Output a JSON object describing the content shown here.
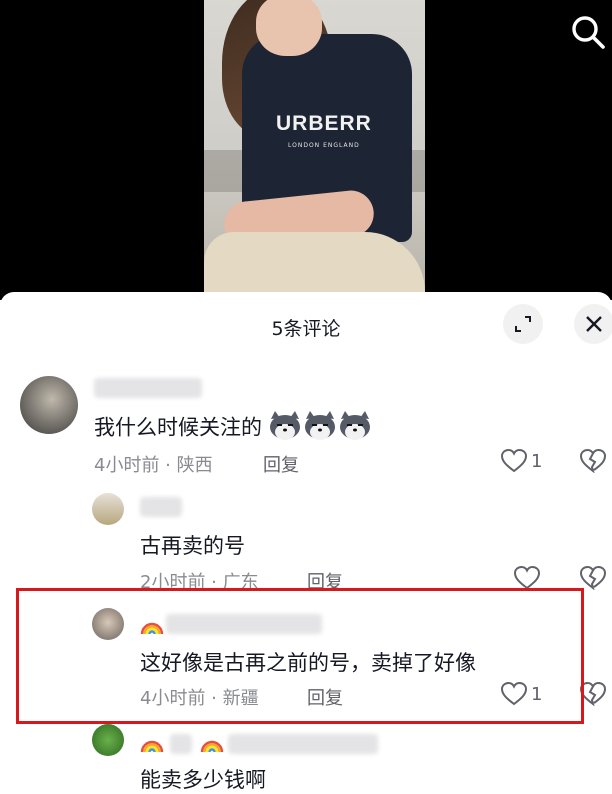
{
  "panel": {
    "title": "5条评论"
  },
  "comments": [
    {
      "text": "我什么时候关注的",
      "emoji_count": 3,
      "time": "4小时前",
      "location": "陕西",
      "reply_label": "回复",
      "likes": "1"
    },
    {
      "text": "古再卖的号",
      "time": "2小时前",
      "location": "广东",
      "reply_label": "回复",
      "likes": ""
    },
    {
      "text": "这好像是古再之前的号，卖掉了好像",
      "time": "4小时前",
      "location": "新疆",
      "reply_label": "回复",
      "likes": "1"
    },
    {
      "text": "能卖多少钱啊"
    }
  ],
  "video": {
    "shirt_text": "URBERR",
    "shirt_subtext": "LONDON ENGLAND"
  },
  "colors": {
    "highlight": "#d7191d",
    "meta": "#8a8b91",
    "text": "#161823"
  },
  "icons": [
    "search-icon",
    "expand-icon",
    "close-icon",
    "heart-icon",
    "broken-heart-icon",
    "husky-emoji-icon",
    "rainbow-icon"
  ]
}
